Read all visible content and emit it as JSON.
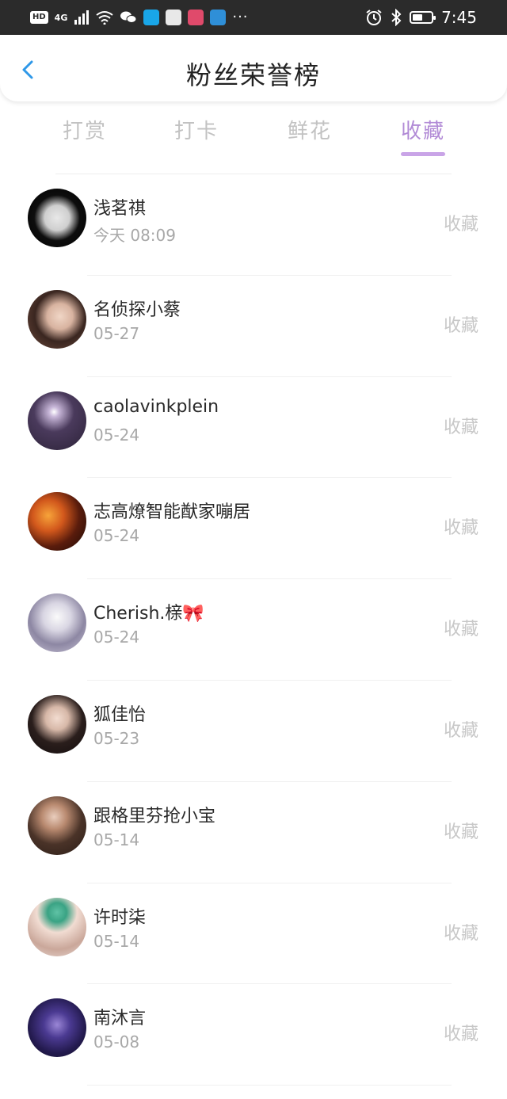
{
  "status_bar": {
    "hd": "HD",
    "network": "4G",
    "more": "···",
    "time": "7:45",
    "battery_level": 0.55
  },
  "header": {
    "title": "粉丝荣誉榜",
    "back_icon": "chevron-left-icon",
    "accent_color": "#2f98e8"
  },
  "tabs": [
    {
      "label": "打赏",
      "active": false
    },
    {
      "label": "打卡",
      "active": false
    },
    {
      "label": "鲜花",
      "active": false
    },
    {
      "label": "收藏",
      "active": true
    }
  ],
  "colors": {
    "active_tab": "#b18ad6",
    "underline": "#c9a4e7"
  },
  "fans": [
    {
      "name": "浅茗祺",
      "time": "今天 08:09",
      "action": "收藏",
      "avatar": "paper-on-dark"
    },
    {
      "name": "名侦探小蔡",
      "time": "05-27",
      "action": "收藏",
      "avatar": "girl-selfie"
    },
    {
      "name": "caolavinkplein",
      "time": "05-24",
      "action": "收藏",
      "avatar": "firework-purple"
    },
    {
      "name": "志高燎智能猷家嘣居",
      "time": "05-24",
      "action": "收藏",
      "avatar": "autumn-leaves"
    },
    {
      "name": "Cherish.榇🎀",
      "time": "05-24",
      "action": "收藏",
      "avatar": "anime-girl"
    },
    {
      "name": "狐佳怡",
      "time": "05-23",
      "action": "收藏",
      "avatar": "girl-dark"
    },
    {
      "name": "跟格里芬抢小宝",
      "time": "05-14",
      "action": "收藏",
      "avatar": "girl-warm"
    },
    {
      "name": "许时柒",
      "time": "05-14",
      "action": "收藏",
      "avatar": "girl-green-cap"
    },
    {
      "name": "南沐言",
      "time": "05-08",
      "action": "收藏",
      "avatar": "night-purple"
    }
  ]
}
